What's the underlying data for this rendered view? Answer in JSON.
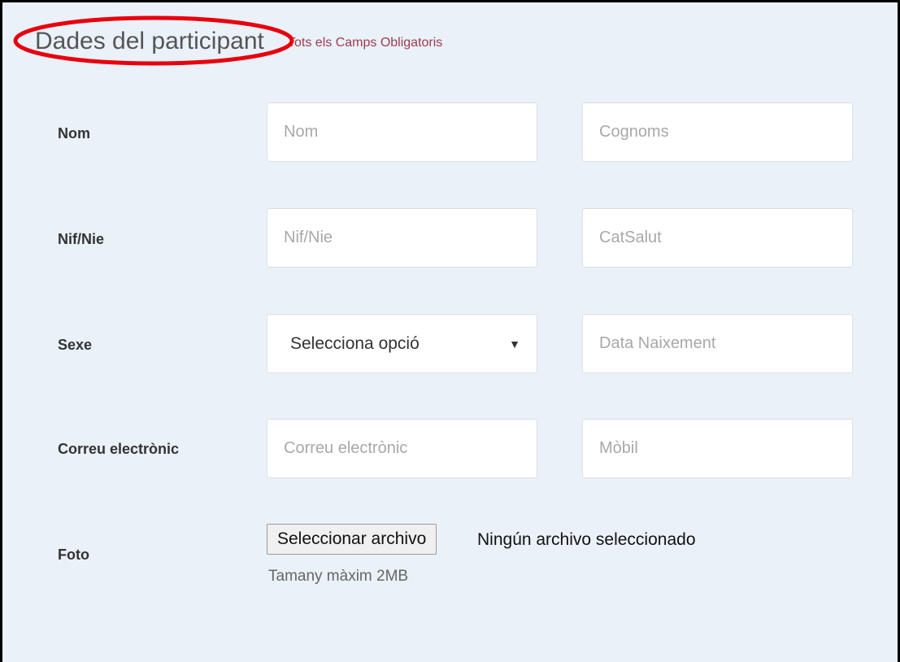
{
  "section": {
    "title": "Dades del participant",
    "required_note": "Tots els Camps Obligatoris",
    "highlight_color": "#e8000d"
  },
  "rows": {
    "nom": {
      "label": "Nom",
      "first_placeholder": "Nom",
      "last_placeholder": "Cognoms"
    },
    "nif": {
      "label": "Nif/Nie",
      "nif_placeholder": "Nif/Nie",
      "catsalut_placeholder": "CatSalut"
    },
    "sexe": {
      "label": "Sexe",
      "select_value": "Selecciona opció",
      "select_arrow_icon": "▼",
      "birth_placeholder": "Data Naixement"
    },
    "email": {
      "label": "Correu electrònic",
      "email_placeholder": "Correu electrònic",
      "mobile_placeholder": "Mòbil"
    },
    "foto": {
      "label": "Foto",
      "button_label": "Seleccionar archivo",
      "status": "Ningún archivo seleccionado",
      "help": "Tamany màxim 2MB"
    }
  }
}
